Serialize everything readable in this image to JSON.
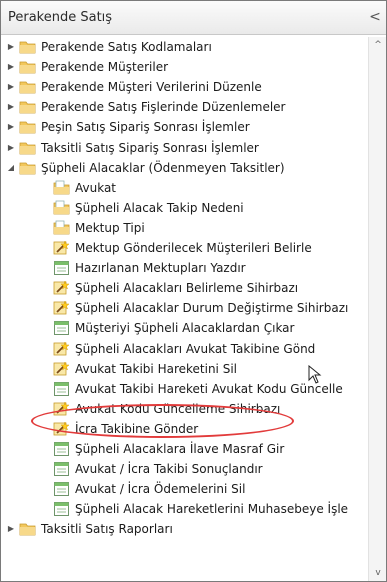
{
  "panel": {
    "title": "Perakende Satış",
    "collapse_glyph": "<"
  },
  "tree": [
    {
      "label": "Perakende Satış Kodlamaları",
      "level": 0,
      "icon": "folder-icon",
      "arrow": "collapsed"
    },
    {
      "label": "Perakende Müşteriler",
      "level": 0,
      "icon": "folder-icon",
      "arrow": "collapsed"
    },
    {
      "label": "Perakende Müşteri Verilerini Düzenle",
      "level": 0,
      "icon": "folder-icon",
      "arrow": "collapsed"
    },
    {
      "label": "Perakende Satış Fişlerinde Düzenlemeler",
      "level": 0,
      "icon": "folder-icon",
      "arrow": "collapsed"
    },
    {
      "label": "Peşin Satış Sipariş Sonrası İşlemler",
      "level": 0,
      "icon": "folder-icon",
      "arrow": "collapsed"
    },
    {
      "label": "Taksitli Satış Sipariş Sonrası İşlemler",
      "level": 0,
      "icon": "folder-icon",
      "arrow": "collapsed"
    },
    {
      "label": "Şüpheli Alacaklar (Ödenmeyen Taksitler)",
      "level": 0,
      "icon": "folder-icon",
      "arrow": "expanded"
    },
    {
      "label": "Avukat",
      "level": 1,
      "icon": "form-folder-icon"
    },
    {
      "label": "Şüpheli Alacak Takip Nedeni",
      "level": 1,
      "icon": "form-folder-icon"
    },
    {
      "label": "Mektup Tipi",
      "level": 1,
      "icon": "form-folder-icon"
    },
    {
      "label": "Mektup Gönderilecek Müşterileri Belirle",
      "level": 1,
      "icon": "wizard-icon"
    },
    {
      "label": "Hazırlanan Mektupları Yazdır",
      "level": 1,
      "icon": "report-icon"
    },
    {
      "label": "Şüpheli Alacakları Belirleme Sihirbazı",
      "level": 1,
      "icon": "wizard-icon"
    },
    {
      "label": "Şüpheli Alacaklar Durum Değiştirme Sihirbazı",
      "level": 1,
      "icon": "wizard-icon"
    },
    {
      "label": "Müşteriyi Şüpheli Alacaklardan Çıkar",
      "level": 1,
      "icon": "report-icon"
    },
    {
      "label": "Şüpheli Alacakları Avukat Takibine Gönd",
      "level": 1,
      "icon": "wizard-icon"
    },
    {
      "label": "Avukat Takibi Hareketini Sil",
      "level": 1,
      "icon": "wizard-icon"
    },
    {
      "label": "Avukat Takibi Hareketi Avukat Kodu Güncelle",
      "level": 1,
      "icon": "report-icon"
    },
    {
      "label": "Avukat Kodu Güncelleme Sihirbazı",
      "level": 1,
      "icon": "wizard-icon"
    },
    {
      "label": "İcra Takibine Gönder",
      "level": 1,
      "icon": "wizard-icon"
    },
    {
      "label": "Şüpheli Alacaklara İlave Masraf Gir",
      "level": 1,
      "icon": "report-icon"
    },
    {
      "label": "Avukat / İcra Takibi Sonuçlandır",
      "level": 1,
      "icon": "report-icon"
    },
    {
      "label": "Avukat / İcra Ödemelerini Sil",
      "level": 1,
      "icon": "report-icon"
    },
    {
      "label": "Şüpheli Alacak Hareketlerini Muhasebeye İşle",
      "level": 1,
      "icon": "report-icon"
    },
    {
      "label": "Taksitli Satış Raporları",
      "level": 0,
      "icon": "folder-icon",
      "arrow": "collapsed"
    }
  ],
  "scrollbar": {
    "up_glyph": "^",
    "down_glyph": "v"
  },
  "colors": {
    "highlight": "#e23b3b",
    "folder": "#f2c75c",
    "report": "#7bbf6a"
  }
}
